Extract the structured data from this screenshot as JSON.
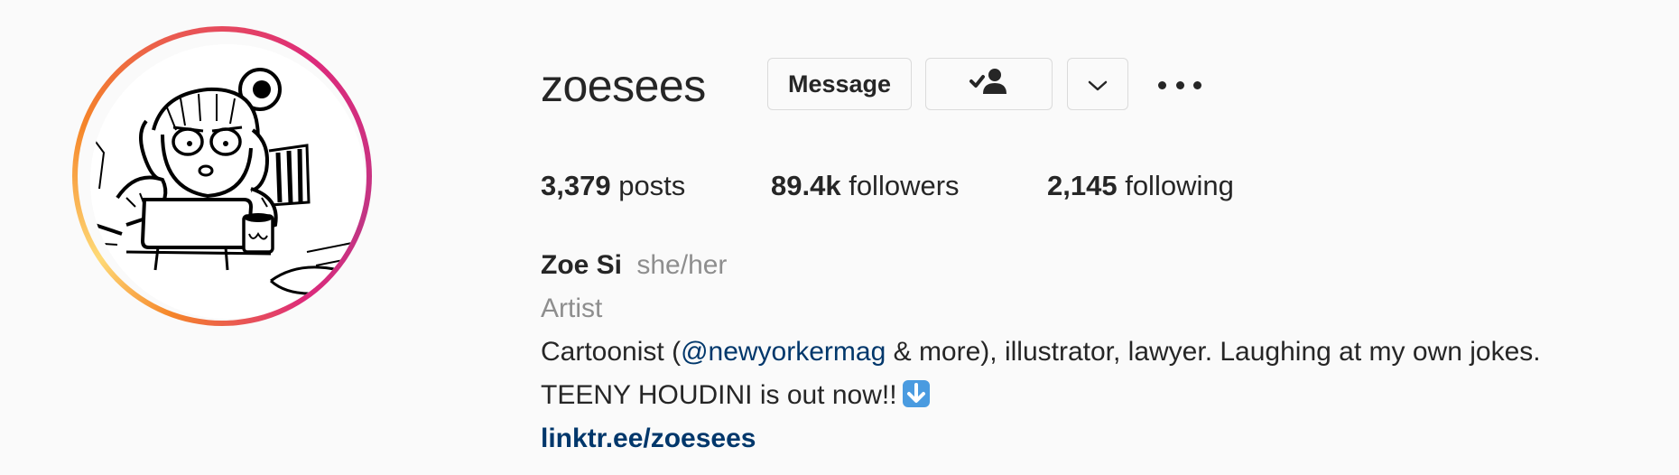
{
  "profile": {
    "username": "zoesees",
    "avatar_icon": "cartoon-avatar",
    "ring_colors": [
      "#f58529",
      "#dd2a7b",
      "#c13584"
    ]
  },
  "actions": {
    "message_label": "Message",
    "follow_icon": "person-check-icon",
    "dropdown_icon": "chevron-down-icon",
    "more_icon": "more-options-icon"
  },
  "stats": {
    "posts_count": "3,379",
    "posts_label": "posts",
    "followers_count": "89.4k",
    "followers_label": "followers",
    "following_count": "2,145",
    "following_label": "following"
  },
  "bio": {
    "full_name": "Zoe Si",
    "pronouns": "she/her",
    "category": "Artist",
    "text_before_mention": "Cartoonist (",
    "mention": "@newyorkermag",
    "text_after_mention": " & more), illustrator, lawyer. Laughing at my own jokes.",
    "line2": "TEENY HOUDINI is out now!!",
    "line2_emoji": "down-arrow-emoji",
    "link": "linktr.ee/zoesees"
  },
  "colors": {
    "text": "#262626",
    "secondary": "#8e8e8e",
    "link": "#00376b",
    "border": "#dbdbdb",
    "background": "#fafafa"
  }
}
